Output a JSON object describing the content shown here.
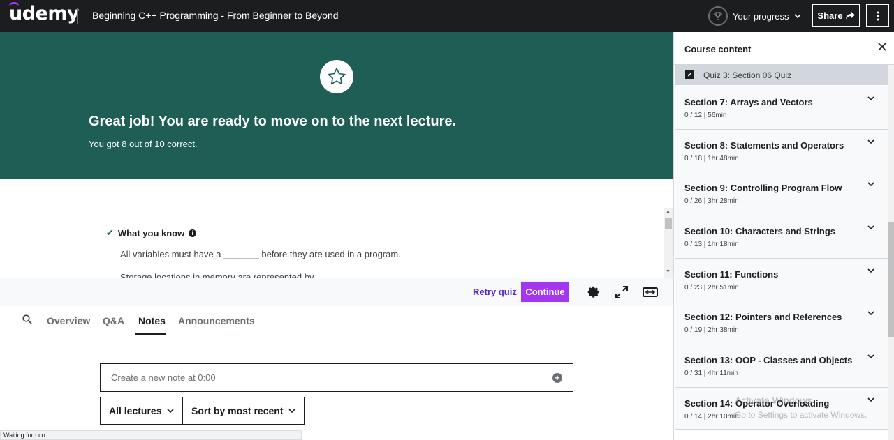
{
  "header": {
    "logo": "udemy",
    "course_title": "Beginning C++ Programming - From Beginner to Beyond",
    "progress_label": "Your progress",
    "share_label": "Share"
  },
  "banner": {
    "title": "Great job! You are ready to move on to the next lecture.",
    "subtitle": "You got 8 out of 10 correct."
  },
  "review": {
    "heading": "What you know",
    "questions": [
      "All variables must have a _______ before they are used in a program.",
      "Storage locations in memory are represented by"
    ]
  },
  "actions": {
    "retry_label": "Retry quiz",
    "continue_label": "Continue"
  },
  "tabs": {
    "items": [
      "Overview",
      "Q&A",
      "Notes",
      "Announcements"
    ],
    "active": "Notes"
  },
  "notes": {
    "placeholder": "Create a new note at 0:00",
    "filter_lectures": "All lectures",
    "sort_label": "Sort by most recent"
  },
  "status_bar": "Waiting for t.co...",
  "sidebar": {
    "title": "Course content",
    "current_item": "Quiz 3: Section 06 Quiz",
    "sections": [
      {
        "title": "Section 7: Arrays and Vectors",
        "meta": "0 / 12 | 56min"
      },
      {
        "title": "Section 8: Statements and Operators",
        "meta": "0 / 18 | 1hr 48min"
      },
      {
        "title": "Section 9: Controlling Program Flow",
        "meta": "0 / 26 | 3hr 28min"
      },
      {
        "title": "Section 10: Characters and Strings",
        "meta": "0 / 13 | 1hr 18min"
      },
      {
        "title": "Section 11: Functions",
        "meta": "0 / 23 | 2hr 51min"
      },
      {
        "title": "Section 12: Pointers and References",
        "meta": "0 / 19 | 2hr 38min"
      },
      {
        "title": "Section 13: OOP - Classes and Objects",
        "meta": "0 / 31 | 4hr 11min"
      },
      {
        "title": "Section 14: Operator Overloading",
        "meta": "0 / 14 | 2hr 10min"
      }
    ]
  },
  "watermark": {
    "line1": "Activate Windows",
    "line2": "Go to Settings to activate Windows."
  },
  "colors": {
    "topbar": "#1c1d1f",
    "banner": "#1e5e55",
    "accent_purple": "#a435f0",
    "link_purple": "#5624d0"
  }
}
